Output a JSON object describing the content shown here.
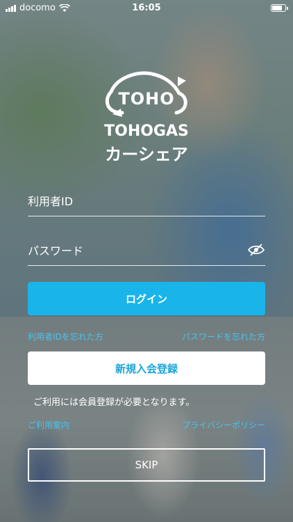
{
  "status_bar": {
    "carrier": "docomo",
    "time": "16:05",
    "battery_level": 0.7
  },
  "logo": {
    "mark_text": "TOHO",
    "brand": "TOHOGAS",
    "service": "カーシェア"
  },
  "form": {
    "user_id_placeholder": "利用者ID",
    "password_placeholder": "パスワード",
    "login_label": "ログイン"
  },
  "links": {
    "forgot_id": "利用者IDを忘れた方",
    "forgot_password": "パスワードを忘れた方",
    "guide": "ご利用案内",
    "privacy": "プライバシーポリシー"
  },
  "register": {
    "label": "新規入会登録",
    "note": "ご利用には会員登録が必要となります。"
  },
  "skip_label": "SKIP",
  "colors": {
    "accent": "#19b5ea",
    "link": "#49c2ee"
  }
}
